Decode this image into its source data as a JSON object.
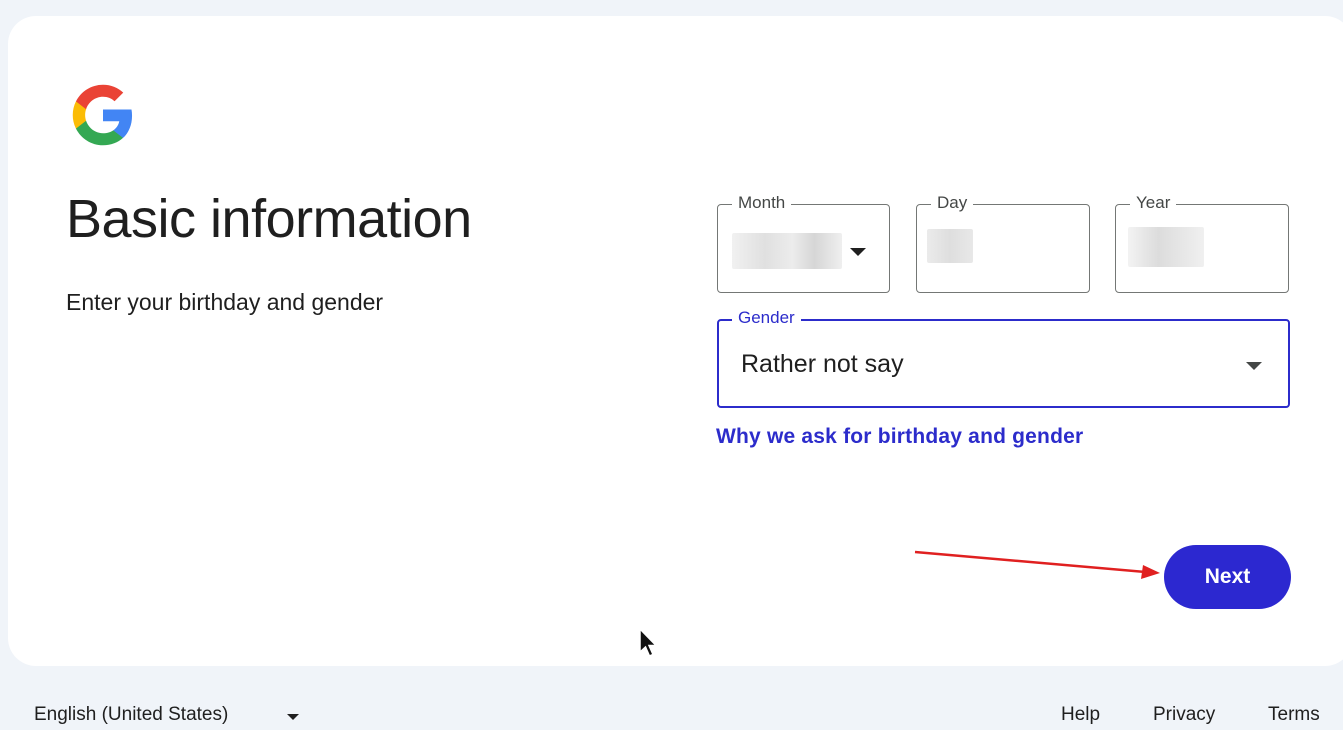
{
  "header": {
    "logo_icon": "google-g-logo-icon"
  },
  "page": {
    "title": "Basic information",
    "subtitle": "Enter your birthday and gender"
  },
  "birthday": {
    "month_label": "Month",
    "day_label": "Day",
    "year_label": "Year"
  },
  "gender": {
    "label": "Gender",
    "value": "Rather not say"
  },
  "links": {
    "why_ask": "Why we ask for birthday and gender"
  },
  "actions": {
    "next_label": "Next"
  },
  "footer": {
    "language": "English (United States)",
    "help": "Help",
    "privacy": "Privacy",
    "terms": "Terms"
  },
  "colors": {
    "accent": "#2c2ccb",
    "next_button": "#2c28d0",
    "background": "#f0f4f9",
    "annotation_arrow": "#e02020"
  }
}
